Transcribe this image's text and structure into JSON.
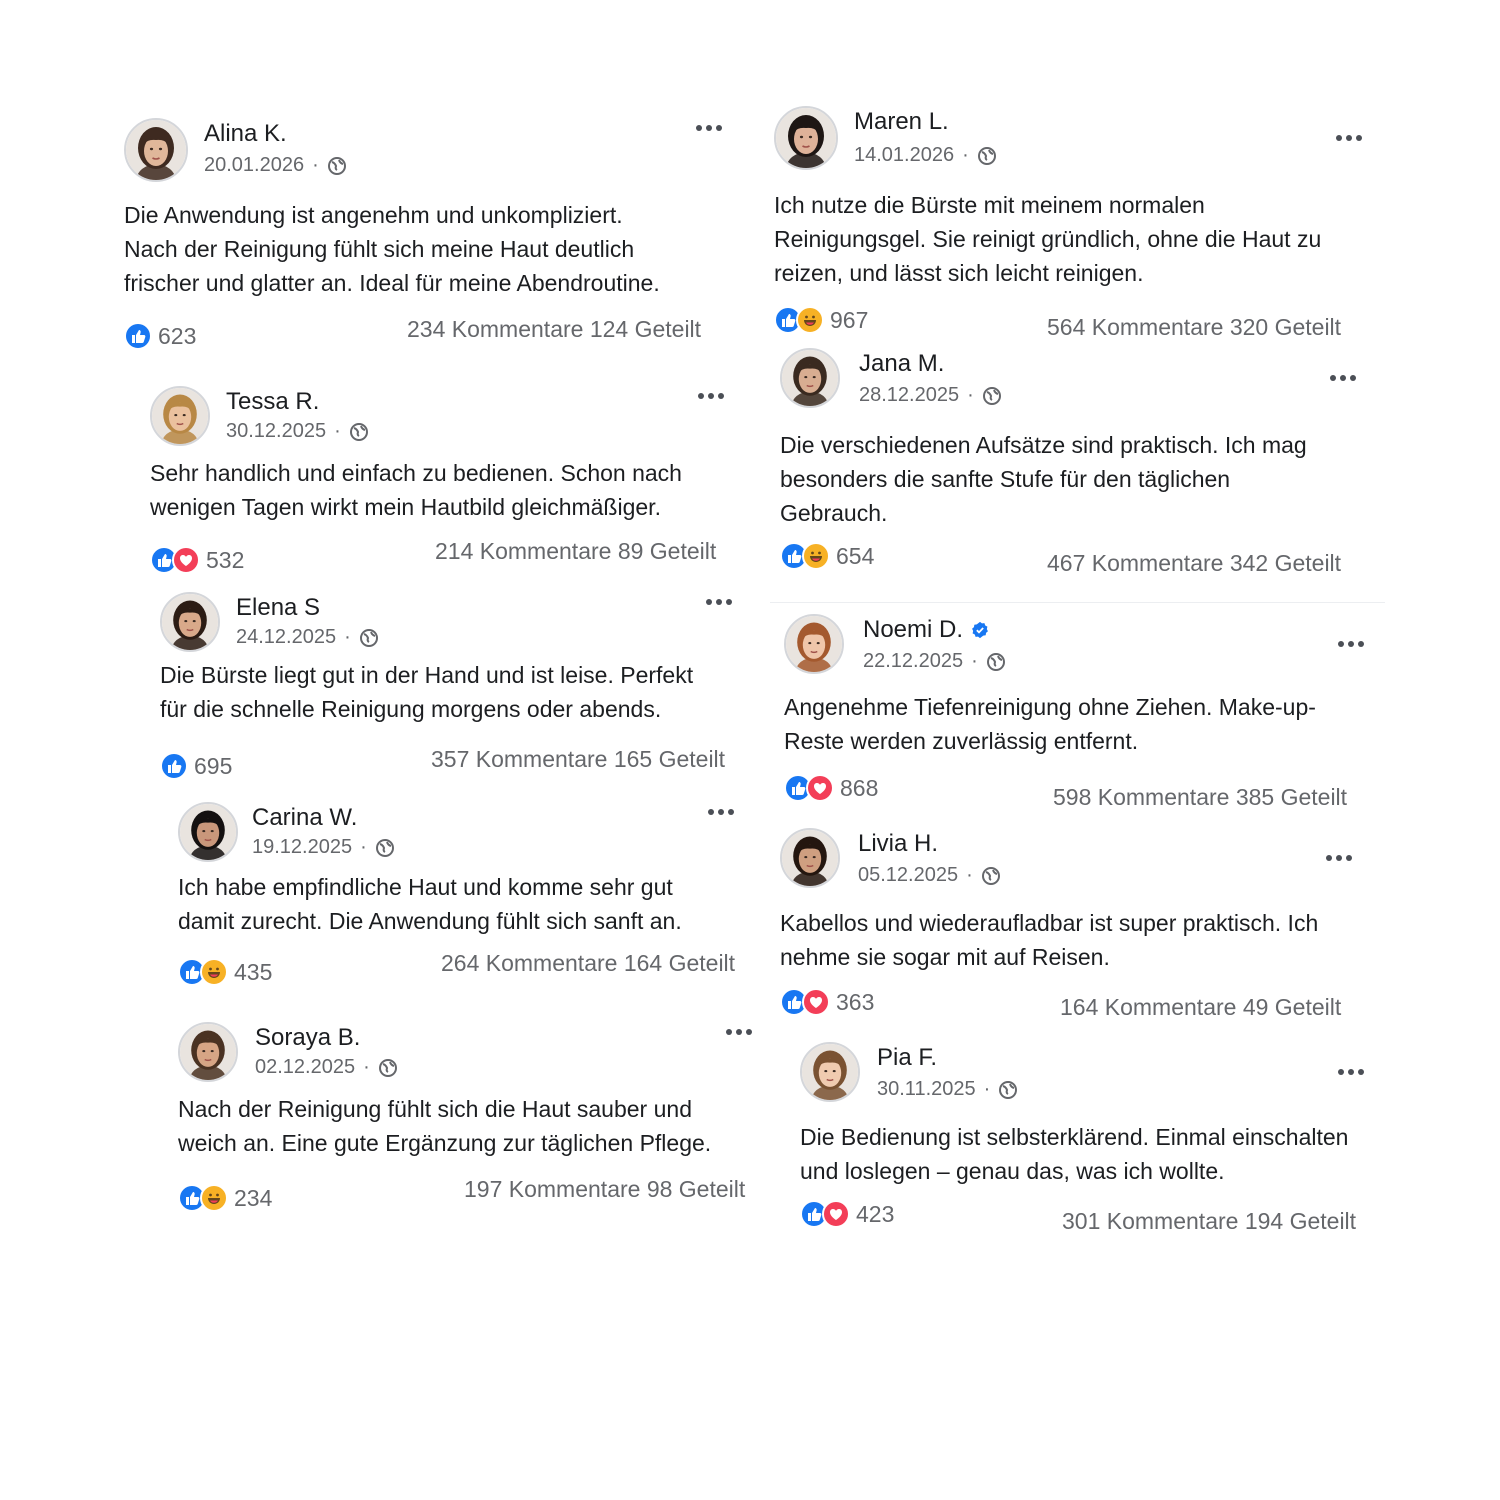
{
  "posts": [
    {
      "name": "Alina K.",
      "date": "20.01.2026",
      "text": "Die Anwendung ist angenehm und unkompliziert.\nNach der Reinigung fühlt sich meine Haut deutlich\nfrischer und glatter an. Ideal für meine Abendroutine.",
      "reactions": "623",
      "stats": "234 Kommentare 124 Geteilt",
      "reaction_types": [
        "like"
      ]
    },
    {
      "name": "Tessa R.",
      "date": "30.12.2025",
      "text": "Sehr handlich und einfach zu bedienen. Schon nach\nwenigen Tagen wirkt mein Hautbild gleichmäßiger.",
      "reactions": "532",
      "stats": "214 Kommentare 89 Geteilt",
      "reaction_types": [
        "like",
        "love"
      ]
    },
    {
      "name": "Elena S",
      "date": "24.12.2025",
      "text": "Die Bürste liegt gut in der Hand und ist leise. Perfekt\nfür die schnelle Reinigung morgens oder abends.",
      "reactions": "695",
      "stats": "357 Kommentare 165 Geteilt",
      "reaction_types": [
        "like"
      ]
    },
    {
      "name": "Carina W.",
      "date": "19.12.2025",
      "text": "Ich habe empfindliche Haut und komme sehr gut\ndamit zurecht. Die Anwendung fühlt sich sanft an.",
      "reactions": "435",
      "stats": "264 Kommentare 164 Geteilt",
      "reaction_types": [
        "like",
        "haha"
      ]
    },
    {
      "name": "Soraya B.",
      "date": "02.12.2025",
      "text": "Nach der Reinigung fühlt sich die Haut sauber und\nweich an. Eine gute Ergänzung zur täglichen Pflege.",
      "reactions": "234",
      "stats": "197 Kommentare 98 Geteilt",
      "reaction_types": [
        "like",
        "haha"
      ]
    },
    {
      "name": "Maren L.",
      "date": "14.01.2026",
      "text": "Ich nutze die Bürste mit meinem normalen\nReinigungsgel. Sie reinigt gründlich, ohne die Haut zu\nreizen, und lässt sich leicht reinigen.",
      "reactions": "967",
      "stats": "564 Kommentare 320 Geteilt",
      "reaction_types": [
        "like",
        "haha"
      ]
    },
    {
      "name": "Jana M.",
      "date": "28.12.2025",
      "text": "Die verschiedenen Aufsätze sind praktisch. Ich mag\nbesonders die sanfte Stufe für den täglichen\nGebrauch.",
      "reactions": "654",
      "stats": "467 Kommentare 342 Geteilt",
      "reaction_types": [
        "like",
        "haha"
      ]
    },
    {
      "name": "Noemi D.",
      "date": "22.12.2025",
      "text": "Angenehme Tiefenreinigung ohne Ziehen. Make-up-\nReste werden zuverlässig entfernt.",
      "reactions": "868",
      "stats": "598 Kommentare 385 Geteilt",
      "reaction_types": [
        "like",
        "love"
      ],
      "verified": true
    },
    {
      "name": "Livia H.",
      "date": "05.12.2025",
      "text": "Kabellos und wiederaufladbar ist super praktisch. Ich\nnehme sie sogar mit auf Reisen.",
      "reactions": "363",
      "stats": "164 Kommentare 49 Geteilt",
      "reaction_types": [
        "like",
        "love"
      ]
    },
    {
      "name": "Pia F.",
      "date": "30.11.2025",
      "text": "Die Bedienung ist selbsterklärend. Einmal einschalten\nund loslegen – genau das, was ich wollte.",
      "reactions": "423",
      "stats": "301 Kommentare 194 Geteilt",
      "reaction_types": [
        "like",
        "love"
      ]
    }
  ],
  "colors": {
    "like": "#1877f2",
    "love": "#f33e58",
    "haha": "#f7b125",
    "verified": "#1877f2",
    "meta": "#65676b"
  }
}
